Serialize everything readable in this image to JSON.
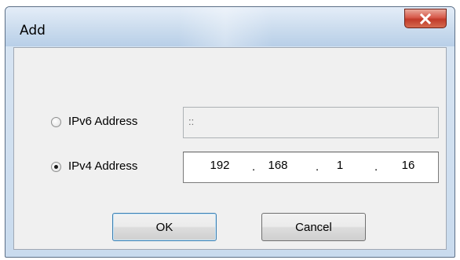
{
  "window": {
    "title": "Add"
  },
  "options": {
    "ipv6": {
      "label": "IPv6 Address",
      "selected": false,
      "value": "::"
    },
    "ipv4": {
      "label": "IPv4 Address",
      "selected": true,
      "octets": [
        "192",
        "168",
        "1",
        "16"
      ],
      "separator": "."
    }
  },
  "buttons": {
    "ok": "OK",
    "cancel": "Cancel"
  },
  "icons": {
    "close": "close-icon",
    "radio_selected": "radio-selected",
    "radio_unselected": "radio-unselected"
  },
  "colors": {
    "close_button": "#c13a2a",
    "dialog_background": "#f0f0f0",
    "title_bar": "#cbdcee"
  }
}
